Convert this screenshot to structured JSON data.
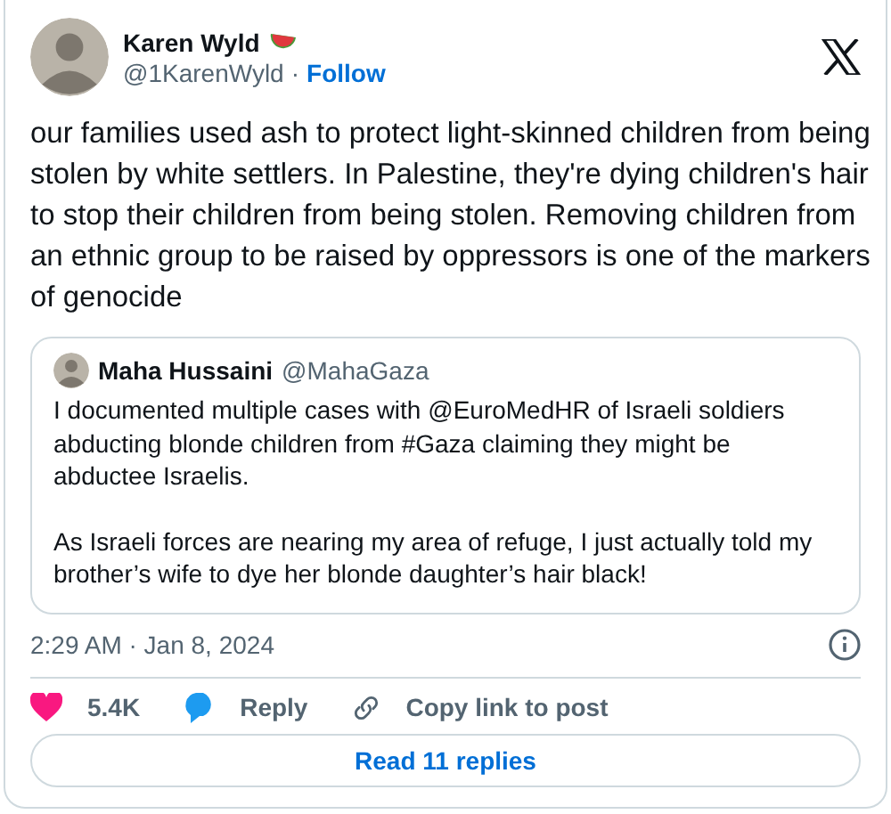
{
  "author": {
    "name": "Karen Wyld",
    "handle": "@1KarenWyld",
    "separator": "·",
    "follow": "Follow"
  },
  "text": "our families used ash to protect light-skinned children from being stolen by white settlers. In Palestine, they're dying children's hair to stop their children from being stolen. Removing children from an ethnic group to be raised by oppressors is one of the markers of genocide",
  "quote": {
    "name": "Maha Hussaini",
    "handle": "@MahaGaza",
    "paragraphs": [
      "I documented multiple cases with @EuroMedHR of Israeli soldiers abducting blonde children from #Gaza claiming they might be abductee Israelis.",
      "As Israeli forces are nearing my area of refuge, I just actually told my brother’s wife to dye her blonde daughter’s hair black!"
    ]
  },
  "timestamp": "2:29 AM · Jan 8, 2024",
  "actions": [
    {
      "kind": "like",
      "label": "5.4K"
    },
    {
      "kind": "reply",
      "label": "Reply"
    },
    {
      "kind": "copy",
      "label": "Copy link to post"
    }
  ],
  "read_replies": "Read 11 replies"
}
